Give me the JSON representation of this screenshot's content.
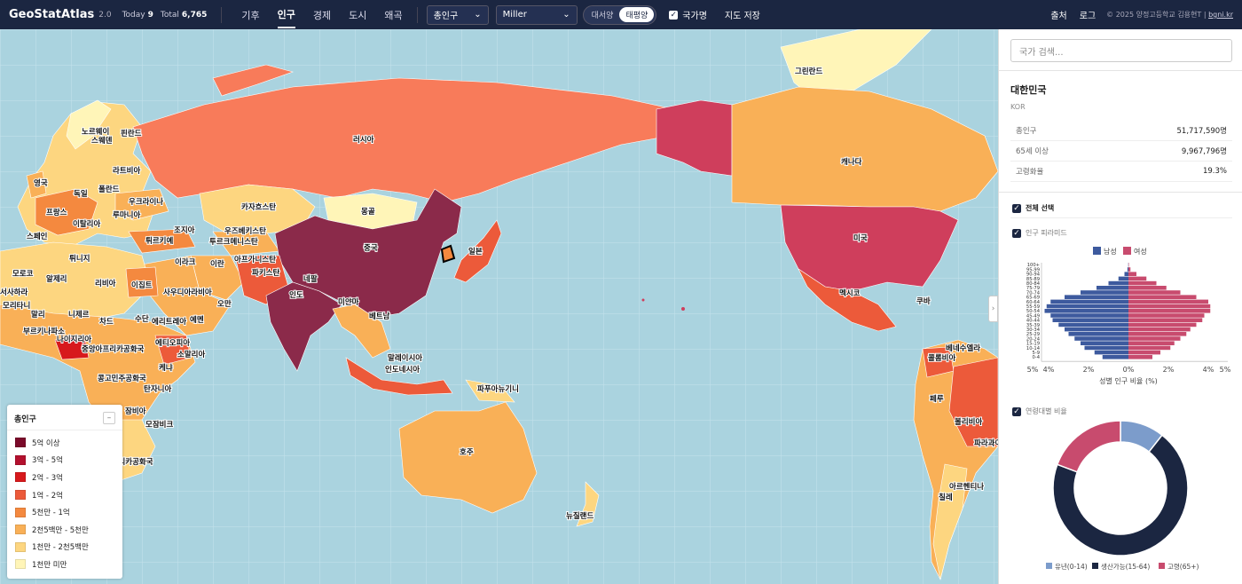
{
  "topbar": {
    "logo": "GeoStatAtlas",
    "version": "2.0",
    "today_label": "Today",
    "today_value": "9",
    "total_label": "Total",
    "total_value": "6,765",
    "nav": [
      "기후",
      "인구",
      "경제",
      "도시",
      "왜곡"
    ],
    "active_nav": "인구",
    "metric_select": "총인구",
    "projection_select": "Miller",
    "ocean_toggle": [
      "대서양",
      "태평양"
    ],
    "ocean_active": "태평양",
    "country_name_checkbox": "국가명",
    "save_map": "지도 저장",
    "source_link": "출처",
    "login_link": "로그",
    "copyright": "© 2025 양정고등학교 김용현T |",
    "copyright_link": "bgni.kr"
  },
  "map": {
    "labels": [
      "러시아",
      "캐나다",
      "미국",
      "중국",
      "몽골",
      "일본",
      "카자흐스탄",
      "우즈베키스탄",
      "투르크메니스탄",
      "아프가니스탄",
      "파키스탄",
      "인도",
      "네팔",
      "미얀마",
      "베트남",
      "말레이시아",
      "인도네시아",
      "파푸아뉴기니",
      "호주",
      "뉴질랜드",
      "그린란드",
      "멕시코",
      "쿠바",
      "베네수엘라",
      "콜롬비아",
      "페루",
      "볼리비아",
      "파라과이",
      "아르헨티나",
      "칠레",
      "노르웨이",
      "스웨덴",
      "핀란드",
      "라트비아",
      "영국",
      "독일",
      "폴란드",
      "우크라이나",
      "프랑스",
      "루마니아",
      "스페인",
      "이탈리아",
      "조지아",
      "튀르키예",
      "이라크",
      "이란",
      "사우디아라비아",
      "오만",
      "예멘",
      "튀니지",
      "알제리",
      "리비아",
      "이집트",
      "모로코",
      "서사하라",
      "모리타니",
      "말리",
      "니제르",
      "차드",
      "수단",
      "에리트레아",
      "부르키나파소",
      "나이지리아",
      "중앙아프리카공화국",
      "에티오피아",
      "소말리아",
      "케냐",
      "콩고민주공화국",
      "탄자니아",
      "잠비아",
      "모잠비크",
      "남아프리카공화국",
      "노르웨이"
    ]
  },
  "legend": {
    "title": "총인구",
    "collapse_symbol": "–",
    "items": [
      {
        "label": "5억 이상",
        "color": "#7a0a2a"
      },
      {
        "label": "3억 - 5억",
        "color": "#b3102e"
      },
      {
        "label": "2억 - 3억",
        "color": "#d7191c"
      },
      {
        "label": "1억 - 2억",
        "color": "#ec5a3a"
      },
      {
        "label": "5천만 - 1억",
        "color": "#f4893f"
      },
      {
        "label": "2천5백만 - 5천만",
        "color": "#f9b057"
      },
      {
        "label": "1천만 - 2천5백만",
        "color": "#fdd680"
      },
      {
        "label": "1천만 미만",
        "color": "#fff5b8"
      }
    ]
  },
  "panel": {
    "search_placeholder": "국가 검색...",
    "country": "대한민국",
    "code": "KOR",
    "stats": [
      {
        "key": "총인구",
        "value": "51,717,590명"
      },
      {
        "key": "65세 이상",
        "value": "9,967,796명"
      },
      {
        "key": "고령화율",
        "value": "19.3%"
      }
    ],
    "select_all": "전체 선택",
    "pyramid_label": "인구 피라미드",
    "age_ratio_label": "연령대별 비율"
  },
  "chart_data": [
    {
      "type": "bar",
      "orientation": "horizontal",
      "title": "",
      "xlabel": "성별 인구 비율 (%)",
      "x_ticks": [
        "5%",
        "4%",
        "2%",
        "0%",
        "2%",
        "4%",
        "5%"
      ],
      "xlim": [
        -5,
        5
      ],
      "categories": [
        "0-4",
        "5-9",
        "10-14",
        "15-19",
        "20-24",
        "25-29",
        "30-34",
        "35-39",
        "40-44",
        "45-49",
        "50-54",
        "55-59",
        "60-64",
        "65-69",
        "70-74",
        "75-79",
        "80-84",
        "85-89",
        "90-94",
        "95-99",
        "100+"
      ],
      "series": [
        {
          "name": "남성",
          "color": "#3d5a9e",
          "values": [
            1.3,
            1.7,
            2.2,
            2.4,
            2.7,
            3.0,
            3.2,
            3.5,
            3.8,
            3.9,
            4.2,
            4.1,
            3.9,
            3.2,
            2.4,
            1.6,
            1.0,
            0.5,
            0.2,
            0.05,
            0.01
          ]
        },
        {
          "name": "여성",
          "color": "#c84b6e",
          "values": [
            1.2,
            1.6,
            2.1,
            2.3,
            2.6,
            2.9,
            3.1,
            3.4,
            3.7,
            3.8,
            4.1,
            4.1,
            4.0,
            3.4,
            2.6,
            1.9,
            1.4,
            0.9,
            0.4,
            0.1,
            0.02
          ]
        }
      ],
      "legend": "top"
    },
    {
      "type": "pie",
      "donut": true,
      "title": "",
      "categories": [
        "유년(0-14)",
        "생산가능(15-64)",
        "고령(65+)"
      ],
      "values": [
        10.6,
        70.1,
        19.3
      ],
      "colors": [
        "#7c9ccb",
        "#1b2641",
        "#c84b6e"
      ],
      "legend": "bottom"
    }
  ]
}
